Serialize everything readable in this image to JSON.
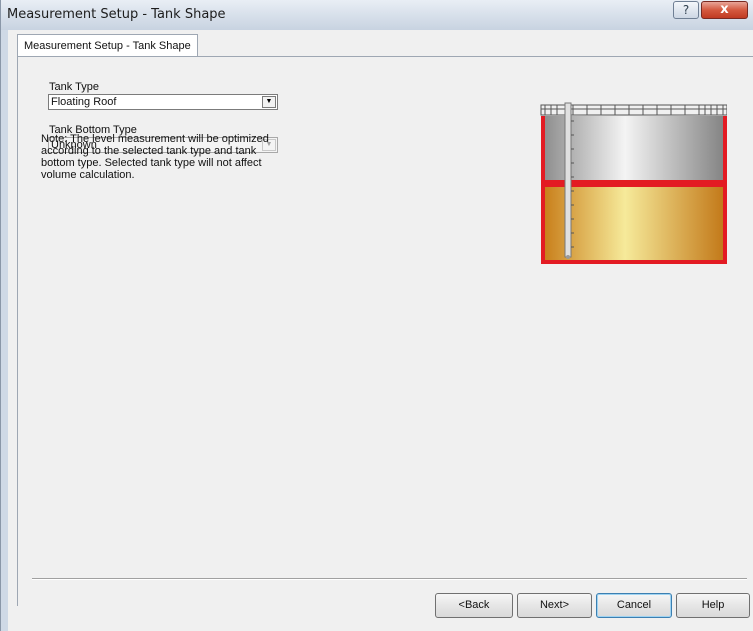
{
  "window": {
    "title": "Measurement Setup - Tank Shape",
    "help_glyph": "?",
    "close_glyph": "x"
  },
  "tab": {
    "label": "Measurement Setup - Tank Shape"
  },
  "form": {
    "tank_type": {
      "label": "Tank Type",
      "value": "Floating Roof",
      "enabled": true
    },
    "tank_bottom_type": {
      "label": "Tank Bottom Type",
      "value": "Unknown",
      "enabled": false
    },
    "note": "Note: The level measurement will be optimized according to the selected tank type and tank bottom type. Selected tank type will not affect volume calculation."
  },
  "illustration": {
    "icon": "floating-roof-tank-illustration",
    "colors": {
      "shell": "#e31b23",
      "roof": "#c8c8c8",
      "liquid": "#e8b84a",
      "gauge": "#8c8c8c"
    }
  },
  "buttons": {
    "back": "<Back",
    "next": "Next>",
    "cancel": "Cancel",
    "help": "Help"
  }
}
